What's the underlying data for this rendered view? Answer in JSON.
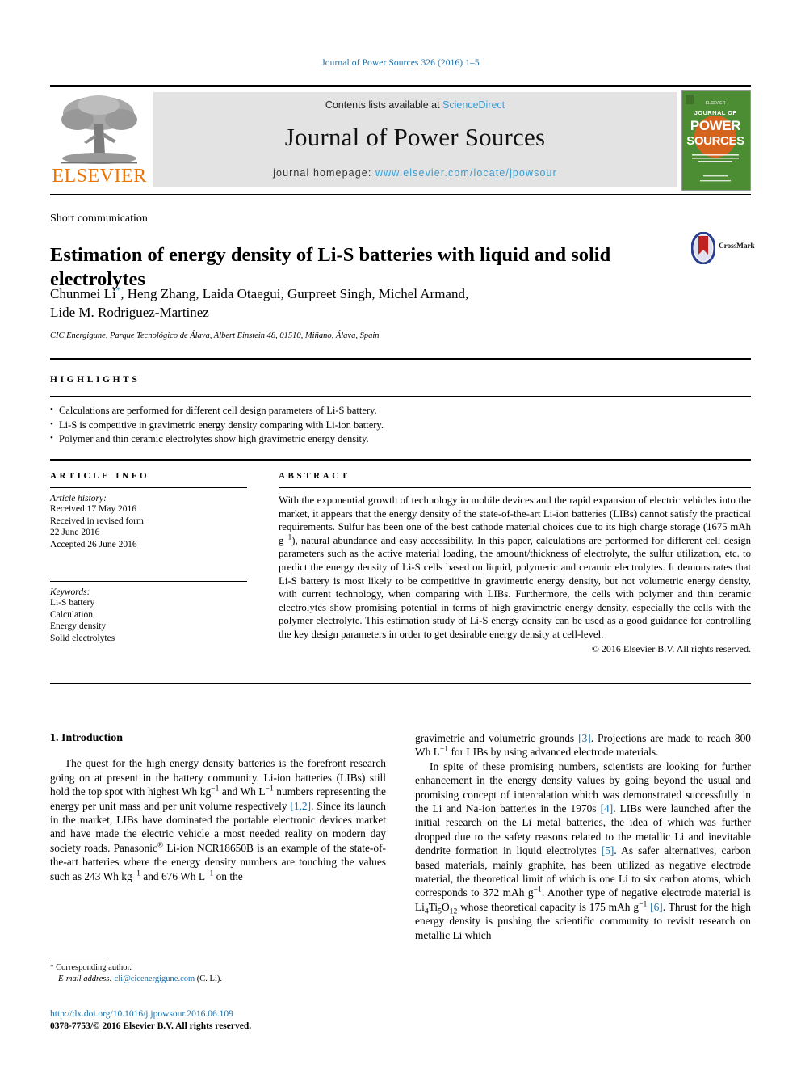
{
  "running_head": "Journal of Power Sources 326 (2016) 1–5",
  "masthead": {
    "publisher": "ELSEVIER",
    "contents_prefix": "Contents lists available at",
    "contents_link": "ScienceDirect",
    "journal_title": "Journal of Power Sources",
    "homepage_prefix": "journal homepage:",
    "homepage_link": "www.elsevier.com/locate/jpowsour",
    "cover": {
      "line1": "JOURNAL OF",
      "line2": "POWER",
      "line3": "SOURCES",
      "blurb": "International journal on the science and technology of electrochemical energy conversion and storage",
      "bg_color": "#4c8c32",
      "accent_color": "#e0601c"
    }
  },
  "article": {
    "doctype": "Short communication",
    "title": "Estimation of energy density of Li-S batteries with liquid and solid electrolytes",
    "authors": "Chunmei Li*, Heng Zhang, Laida Otaegui, Gurpreet Singh, Michel Armand, Lide M. Rodriguez-Martinez",
    "authors_line1_pre": "Chunmei Li",
    "authors_line1_post": ", Heng Zhang, Laida Otaegui, Gurpreet Singh, Michel Armand,",
    "authors_line2": "Lide M. Rodriguez-Martinez",
    "corresponding_marker": "*",
    "affiliation": "CIC Energigune, Parque Tecnológico de Álava, Albert Einstein 48, 01510, Miñano, Álava, Spain",
    "crossmark_label": "CrossMark"
  },
  "highlights": {
    "heading": "HIGHLIGHTS",
    "items": [
      "Calculations are performed for different cell design parameters of Li-S battery.",
      "Li-S is competitive in gravimetric energy density comparing with Li-ion battery.",
      "Polymer and thin ceramic electrolytes show high gravimetric energy density."
    ]
  },
  "article_info": {
    "heading": "ARTICLE INFO",
    "history_label": "Article history:",
    "history_lines": [
      "Received 17 May 2016",
      "Received in revised form",
      "22 June 2016",
      "Accepted 26 June 2016"
    ],
    "keywords_label": "Keywords:",
    "keywords": [
      "Li-S battery",
      "Calculation",
      "Energy density",
      "Solid electrolytes"
    ]
  },
  "abstract": {
    "heading": "ABSTRACT",
    "p1_a": "With the exponential growth of technology in mobile devices and the rapid expansion of electric vehicles into the market, it appears that the energy density of the state-of-the-art Li-ion batteries (LIBs) cannot satisfy the practical requirements. Sulfur has been one of the best cathode material choices due to its high charge storage (1675 mAh g",
    "p1_sup": "−1",
    "p1_b": "), natural abundance and easy accessibility. In this paper, calculations are performed for different cell design parameters such as the active material loading, the amount/thickness of electrolyte, the sulfur utilization, etc. to predict the energy density of Li-S cells based on liquid, polymeric and ceramic electrolytes. It demonstrates that Li-S battery is most likely to be competitive in gravimetric energy density, but not volumetric energy density, with current technology, when comparing with LIBs. Furthermore, the cells with polymer and thin ceramic electrolytes show promising potential in terms of high gravimetric energy density, especially the cells with the polymer electrolyte. This estimation study of Li-S energy density can be used as a good guidance for controlling the key design parameters in order to get desirable energy density at cell-level.",
    "copyright": "© 2016 Elsevier B.V. All rights reserved."
  },
  "body": {
    "section_number_title": "1. Introduction",
    "left_p1_a": "The quest for the high energy density batteries is the forefront research going on at present in the battery community. Li-ion batteries (LIBs) still hold the top spot with highest Wh kg",
    "left_p1_sup1": "−1",
    "left_p1_b": " and Wh L",
    "left_p1_sup2": "−1",
    "left_p1_c": " numbers representing the energy per unit mass and per unit volume respectively ",
    "left_p1_ref1": "[1,2]",
    "left_p1_d": ". Since its launch in the market, LIBs have dominated the portable electronic devices market and have made the electric vehicle a most needed reality on modern day society roads. Panasonic",
    "left_p1_reg": "®",
    "left_p1_e": " Li-ion NCR18650B is an example of the state-of-the-art batteries where the energy density numbers are touching the values such as 243 Wh kg",
    "left_p1_sup3": "−1",
    "left_p1_f": " and 676 Wh L",
    "left_p1_sup4": "−1",
    "left_p1_g": " on the",
    "right_p1_a": "gravimetric and volumetric grounds ",
    "right_p1_ref": "[3]",
    "right_p1_b": ". Projections are made to reach 800 Wh L",
    "right_p1_sup": "−1",
    "right_p1_c": " for LIBs by using advanced electrode materials.",
    "right_p2_a": "In spite of these promising numbers, scientists are looking for further enhancement in the energy density values by going beyond the usual and promising concept of intercalation which was demonstrated successfully in the Li and Na-ion batteries in the 1970s ",
    "right_p2_ref1": "[4]",
    "right_p2_b": ". LIBs were launched after the initial research on the Li metal batteries, the idea of which was further dropped due to the safety reasons related to the metallic Li and inevitable dendrite formation in liquid electrolytes ",
    "right_p2_ref2": "[5]",
    "right_p2_c": ". As safer alternatives, carbon based materials, mainly graphite, has been utilized as negative electrode material, the theoretical limit of which is one Li to six carbon atoms, which corresponds to 372 mAh g",
    "right_p2_sup1": "−1",
    "right_p2_d": ". Another type of negative electrode material is Li",
    "right_p2_sub1": "4",
    "right_p2_e": "Ti",
    "right_p2_sub2": "5",
    "right_p2_f": "O",
    "right_p2_sub3": "12",
    "right_p2_g": " whose theoretical capacity is 175 mAh g",
    "right_p2_sup2": "−1",
    "right_p2_h": " ",
    "right_p2_ref3": "[6]",
    "right_p2_i": ". Thrust for the high energy density is pushing the scientific community to revisit research on metallic Li which"
  },
  "footnote": {
    "star": "*",
    "corresponding": "Corresponding author.",
    "email_label": "E-mail address:",
    "email": "cli@cicenergigune.com",
    "email_suffix": "(C. Li)."
  },
  "footer": {
    "doi": "http://dx.doi.org/10.1016/j.jpowsour.2016.06.109",
    "issn_line": "0378-7753/© 2016 Elsevier B.V. All rights reserved."
  },
  "colors": {
    "link": "#3b9dd2",
    "ref": "#1a6fa8",
    "elsevier_orange": "#ec7404",
    "masthead_bg": "#e3e3e3"
  }
}
